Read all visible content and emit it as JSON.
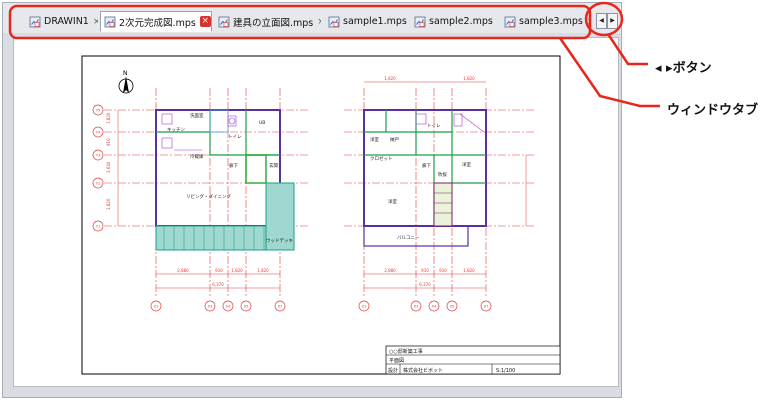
{
  "tabs": [
    {
      "label": "DRAWIN1",
      "icon": "drawing-file-icon",
      "active": false
    },
    {
      "label": "2次元完成図.mps",
      "icon": "drawing-file-icon",
      "active": true
    },
    {
      "label": "建具の立面図.mps",
      "icon": "drawing-file-icon",
      "active": false
    },
    {
      "label": "sample1.mps",
      "icon": "drawing-file-icon",
      "active": false
    },
    {
      "label": "sample2.mps",
      "icon": "drawing-file-icon",
      "active": false
    },
    {
      "label": "sample3.mps",
      "icon": "drawing-file-icon",
      "active": false
    }
  ],
  "tab_close_glyph": "×",
  "scroll_buttons": {
    "left": "◀",
    "right": "▶"
  },
  "annotations": {
    "buttons_label": "◂ ▸ボタン",
    "tabs_label": "ウィンドウタブ",
    "highlight_color": "#e8261c"
  },
  "drawing": {
    "north_mark": "N",
    "left_plan_rooms": [
      "洗面室",
      "トイレ",
      "キッチン",
      "UB",
      "廊下",
      "冷蔵庫",
      "玄関",
      "リビング・ダイニング",
      "ウッドデッキ"
    ],
    "right_plan_rooms": [
      "洋室",
      "納戸",
      "トイレ",
      "クロゼット",
      "洋室",
      "廊下",
      "吹抜",
      "洋室",
      "バルコニー"
    ],
    "left_dims_bottom": [
      "2,880",
      "910",
      "1,820",
      "1,820"
    ],
    "left_dim_total": "6,370",
    "right_dims_bottom": [
      "2,880",
      "910",
      "910",
      "1,820"
    ],
    "right_dim_total": "6,370",
    "top_dim_right": "1,820",
    "top_dim_right2": "1,820",
    "left_side_dims": [
      "1,820",
      "910",
      "3,640",
      "1,820"
    ],
    "grid_labels_left": [
      "Y5",
      "Y4",
      "Y3",
      "Y2",
      "Y1"
    ],
    "grid_labels_bottom": [
      "X1",
      "X3",
      "X4",
      "X5",
      "X7"
    ],
    "grid_labels_bottom_right": [
      "X1",
      "X3",
      "X4",
      "X5",
      "X7"
    ],
    "title_block": {
      "project": "○○邸新築工事",
      "drawing_name": "平面図",
      "designer_label": "設計",
      "designer": "株式会社ビボット",
      "scale": "S:1/100"
    }
  }
}
